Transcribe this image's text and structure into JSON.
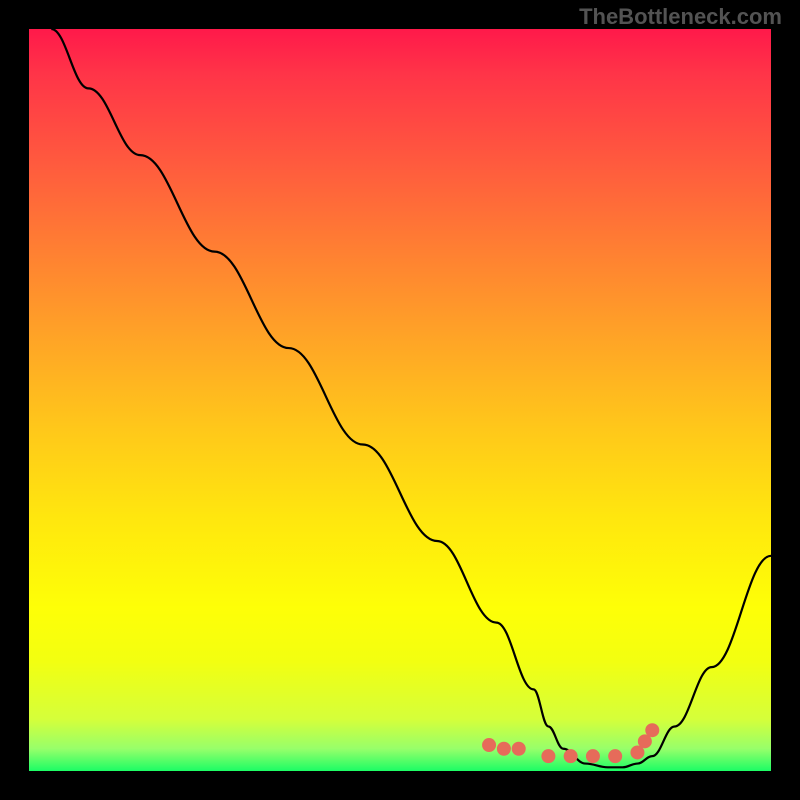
{
  "watermark": "TheBottleneck.com",
  "chart_data": {
    "type": "line",
    "title": "",
    "xlabel": "",
    "ylabel": "",
    "xlim": [
      0,
      100
    ],
    "ylim": [
      0,
      100
    ],
    "series": [
      {
        "name": "curve",
        "x": [
          3,
          8,
          15,
          25,
          35,
          45,
          55,
          63,
          68,
          70,
          72,
          75,
          78,
          80,
          82,
          84,
          87,
          92,
          100
        ],
        "y": [
          100,
          92,
          83,
          70,
          57,
          44,
          31,
          20,
          11,
          6,
          3,
          1,
          0.5,
          0.5,
          1,
          2,
          6,
          14,
          29
        ]
      },
      {
        "name": "trough-dots",
        "x": [
          62,
          64,
          66,
          70,
          73,
          76,
          79,
          82,
          83,
          84
        ],
        "y": [
          3.5,
          3,
          3,
          2,
          2,
          2,
          2,
          2.5,
          4,
          5.5
        ]
      }
    ],
    "colors": {
      "curve": "#000000",
      "dots": "#e66b5a"
    }
  }
}
